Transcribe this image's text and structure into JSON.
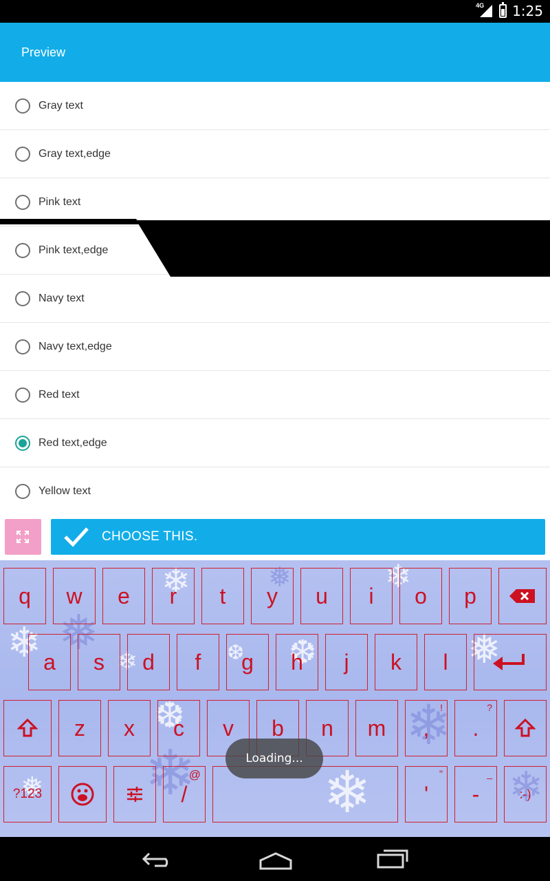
{
  "status_bar": {
    "time": "1:25",
    "network": "4G"
  },
  "app_bar": {
    "title": "Preview"
  },
  "options": [
    {
      "label": "Gray text",
      "checked": false
    },
    {
      "label": "Gray text,edge",
      "checked": false
    },
    {
      "label": "Pink text",
      "checked": false
    },
    {
      "label": "Pink text,edge",
      "checked": false
    },
    {
      "label": "Navy text",
      "checked": false
    },
    {
      "label": "Navy text,edge",
      "checked": false
    },
    {
      "label": "Red text",
      "checked": false
    },
    {
      "label": "Red text,edge",
      "checked": true
    },
    {
      "label": "Yellow text",
      "checked": false
    }
  ],
  "actions": {
    "choose_label": "CHOOSE THIS.",
    "expand_icon": "expand-icon",
    "check_icon": "check-icon"
  },
  "keyboard": {
    "row1": [
      "q",
      "w",
      "e",
      "r",
      "t",
      "y",
      "u",
      "i",
      "o",
      "p"
    ],
    "row2": [
      "a",
      "s",
      "d",
      "f",
      "g",
      "h",
      "j",
      "k",
      "l"
    ],
    "row3": [
      "z",
      "x",
      "c",
      "v",
      "b",
      "n",
      "m"
    ],
    "row3_hints": {
      "comma": "!",
      "period": "?"
    },
    "row4": {
      "symbols": "?123",
      "slash": "/",
      "slash_hint": "@",
      "apostrophe": "'",
      "apostrophe_hint": "\"",
      "dash": "-",
      "dash_hint": "_",
      "smiley": ":-)"
    },
    "punctuation": {
      "comma": ",",
      "period": "."
    },
    "text_color": "#cc1122"
  },
  "toast": {
    "text": "Loading..."
  },
  "colors": {
    "app_bar": "#12ade8",
    "radio_checked": "#1aa399",
    "expand_button": "#f3a0c8"
  }
}
